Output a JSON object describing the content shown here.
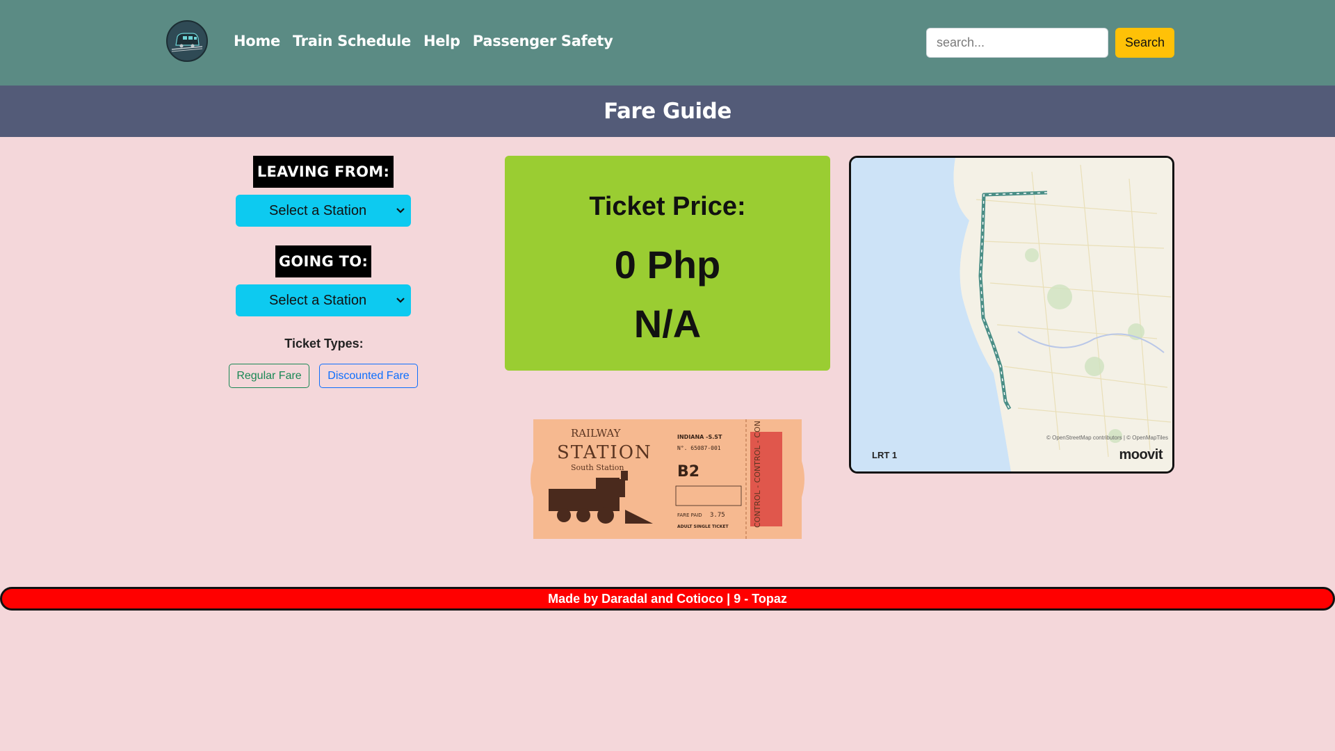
{
  "nav": {
    "links": [
      {
        "label": "Home"
      },
      {
        "label": "Train Schedule"
      },
      {
        "label": "Help"
      },
      {
        "label": "Passenger Safety"
      }
    ],
    "search_placeholder": "search...",
    "search_button": "Search"
  },
  "page": {
    "title": "Fare Guide"
  },
  "form": {
    "leaving_label": "LEAVING FROM:",
    "leaving_value": "Select a Station",
    "going_label": "GOING TO:",
    "going_value": "Select a Station",
    "ticket_types_label": "Ticket Types:",
    "regular_fare": "Regular Fare",
    "discounted_fare": "Discounted Fare"
  },
  "price": {
    "label": "Ticket Price:",
    "value": "0 Php",
    "type": "N/A"
  },
  "map": {
    "line_label": "LRT 1",
    "brand": "moovit",
    "attribution": "© OpenStreetMap contributors | © OpenMapTiles"
  },
  "ticket": {
    "railway": "RAILWAY",
    "station": "STATION",
    "south_station": "South Station",
    "route": "INDIANA -S.ST",
    "number": "N°. 65087-001",
    "seat": "B2",
    "fare_label": "FARE PAID",
    "fare_value": "3.75",
    "ticket_kind": "ADULT SINGLE TICKET",
    "stub": "CONTROL - CONTROL - CON"
  },
  "footer": {
    "text": "Made by Daradal and Cotioco | 9 - Topaz"
  },
  "colors": {
    "navbar": "#5b8b84",
    "title_bar": "#535b78",
    "background": "#f4d7da",
    "select": "#0dcaf0",
    "price_card": "#9acd32",
    "search_button": "#ffc107",
    "footer": "#ff0000"
  }
}
